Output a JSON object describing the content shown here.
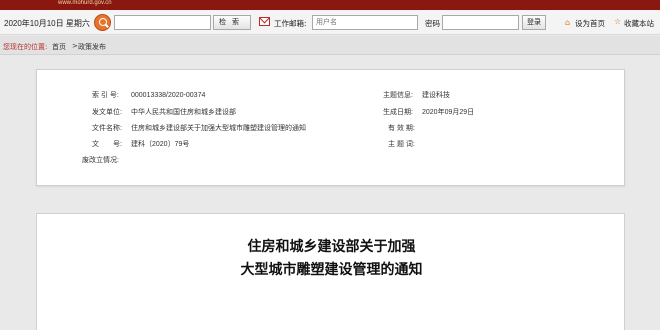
{
  "banner": {
    "site_text": "www.mohurd.gov.cn"
  },
  "toolbar": {
    "date": "2020年10月10日 星期六",
    "search_value": "",
    "search_button": "检索",
    "mail_label": "工作邮箱:",
    "user_placeholder": "用户名",
    "password_label": "密码",
    "login_button": "登录",
    "home_link": "设为首页",
    "favorite_link": "收藏本站",
    "colors": {
      "banner": "#8a1710",
      "accent_orange": "#e8742b",
      "mail_red": "#c0282a"
    }
  },
  "breadcrumb": {
    "label": "您现在的位置:",
    "home": "首页",
    "separator": ">",
    "current": "政策发布"
  },
  "info": {
    "index_label": "索 引 号:",
    "index_value": "000013338/2020-00374",
    "topic_label": "主题信息:",
    "topic_value": "建设科技",
    "issuer_label": "发文单位:",
    "issuer_value": "中华人民共和国住房和城乡建设部",
    "date_label": "生成日期:",
    "date_value": "2020年09月29日",
    "filename_label": "文件名称:",
    "filename_value": "住房和城乡建设部关于加强大型城市雕塑建设管理的通知",
    "validity_label": "有 效 期:",
    "validity_value": "",
    "docno_label": "文　　号:",
    "docno_value": "建科〔2020〕79号",
    "keywords_label": "主 题 词:",
    "keywords_value": "",
    "abolish_label": "废改立情况:",
    "abolish_value": ""
  },
  "article": {
    "title_line1": "住房和城乡建设部关于加强",
    "title_line2": "大型城市雕塑建设管理的通知"
  }
}
